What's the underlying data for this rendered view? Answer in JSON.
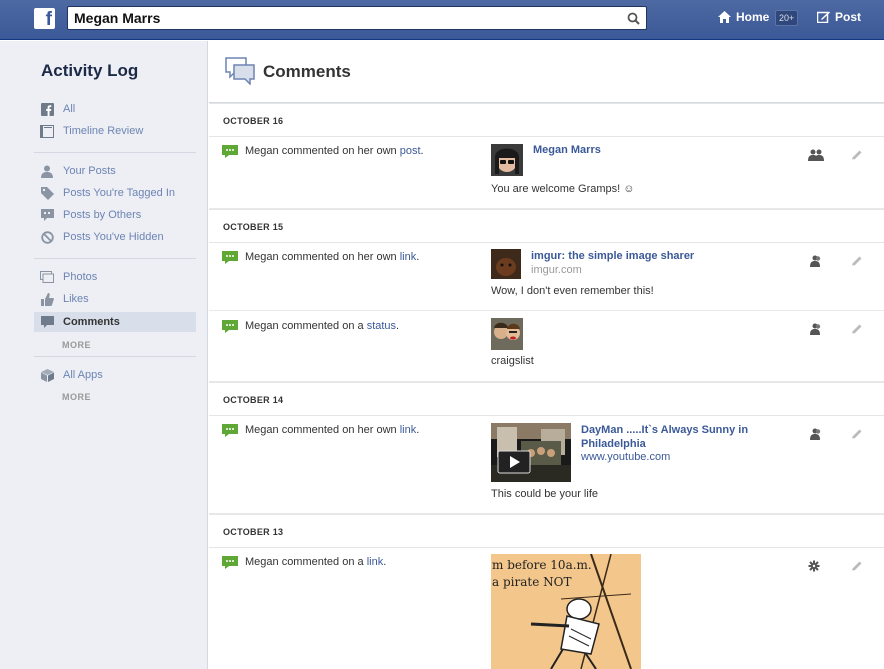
{
  "topbar": {
    "logo": "f",
    "search_value": "Megan Marrs",
    "home_label": "Home",
    "home_badge": "20+",
    "post_label": "Post"
  },
  "sidebar": {
    "title": "Activity Log",
    "items": [
      {
        "label": "All",
        "icon": "facebook-icon"
      },
      {
        "label": "Timeline Review",
        "icon": "timeline-icon"
      },
      {
        "label": "Your Posts",
        "icon": "person-icon"
      },
      {
        "label": "Posts You're Tagged In",
        "icon": "tag-icon"
      },
      {
        "label": "Posts by Others",
        "icon": "comment-bubble-icon"
      },
      {
        "label": "Posts You've Hidden",
        "icon": "hidden-icon"
      },
      {
        "label": "Photos",
        "icon": "photos-icon"
      },
      {
        "label": "Likes",
        "icon": "like-icon"
      },
      {
        "label": "Comments",
        "icon": "comment-icon"
      },
      {
        "label": "All Apps",
        "icon": "apps-cube-icon"
      }
    ],
    "more_label": "MORE"
  },
  "main": {
    "title": "Comments",
    "groups": [
      {
        "date": "OCTOBER 16",
        "entries": [
          {
            "prefix": "Megan commented on her own ",
            "link": "post",
            "suffix": ".",
            "target_title": "Megan Marrs",
            "comment": "You are welcome Gramps! ☺"
          }
        ]
      },
      {
        "date": "OCTOBER 15",
        "entries": [
          {
            "prefix": "Megan commented on her own ",
            "link": "link",
            "suffix": ".",
            "target_title": "imgur: the simple image sharer",
            "target_sub": "imgur.com",
            "comment": "Wow, I don't even remember this!"
          },
          {
            "prefix": "Megan commented on a ",
            "link": "status",
            "suffix": ".",
            "comment": "craigslist"
          }
        ]
      },
      {
        "date": "OCTOBER 14",
        "entries": [
          {
            "prefix": "Megan commented on her own ",
            "link": "link",
            "suffix": ".",
            "target_title": "DayMan .....It`s Always Sunny in Philadelphia",
            "target_sub": "www.youtube.com",
            "comment": "This could be your life"
          }
        ]
      },
      {
        "date": "OCTOBER 13",
        "entries": [
          {
            "prefix": "Megan commented on a ",
            "link": "link",
            "suffix": ".",
            "image_text_1": "m before 10a.m.",
            "image_text_2": "a pirate NOT"
          }
        ]
      }
    ]
  }
}
